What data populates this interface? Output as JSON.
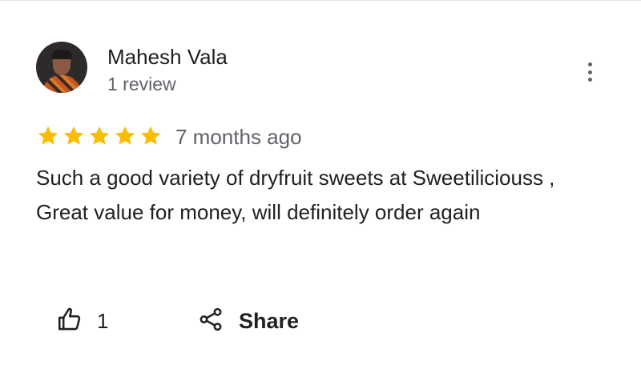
{
  "review": {
    "author": "Mahesh Vala",
    "author_meta": "1 review",
    "rating": 5,
    "rating_max": 5,
    "time": "7 months ago",
    "text": "Such a good variety of dryfruit sweets at Sweetiliciouss , Great value for money, will definitely order again"
  },
  "actions": {
    "like_count": "1",
    "share_label": "Share"
  },
  "icons": {
    "menu": "more-vertical-icon",
    "star": "star-icon",
    "like": "thumbs-up-icon",
    "share": "share-icon"
  },
  "colors": {
    "star": "#fbbc04",
    "primary_text": "#202124",
    "secondary_text": "#5f6368"
  }
}
